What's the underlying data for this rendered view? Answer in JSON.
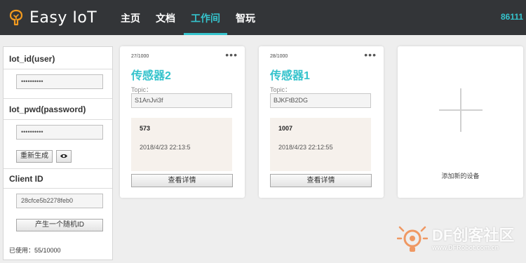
{
  "header": {
    "logo_text": "Easy IoT",
    "nav": [
      {
        "label": "主页"
      },
      {
        "label": "文档"
      },
      {
        "label": "工作间"
      },
      {
        "label": "智玩"
      }
    ],
    "phone": "86111",
    "accent_color": "#35c3cc"
  },
  "credentials": {
    "iot_id_label": "Iot_id(user)",
    "iot_id_value": "••••••••••",
    "iot_pwd_label": "Iot_pwd(password)",
    "iot_pwd_value": "••••••••••",
    "regenerate_label": "重新生成",
    "show_icon": "eye-icon",
    "client_id_label": "Client ID",
    "client_id_value": "28cfce5b2278feb0",
    "random_id_button": "产生一个随机ID",
    "used": "已使用：55/10000"
  },
  "devices": [
    {
      "count": "27/1000",
      "name": "传感器2",
      "topic_label": "Topic：",
      "topic": "S1AnJvi3f",
      "value": "573",
      "time": "2018/4/23 22:13:5",
      "details_label": "查看详情"
    },
    {
      "count": "28/1000",
      "name": "传感器1",
      "topic_label": "Topic：",
      "topic": "BJKFtB2DG",
      "value": "1007",
      "time": "2018/4/23 22:12:55",
      "details_label": "查看详情"
    }
  ],
  "add_device": {
    "label": "添加新的设备",
    "icon": "plus-icon"
  },
  "watermark": {
    "brand": "DF创客社区",
    "url": "www.DFRobot.com.cn"
  }
}
